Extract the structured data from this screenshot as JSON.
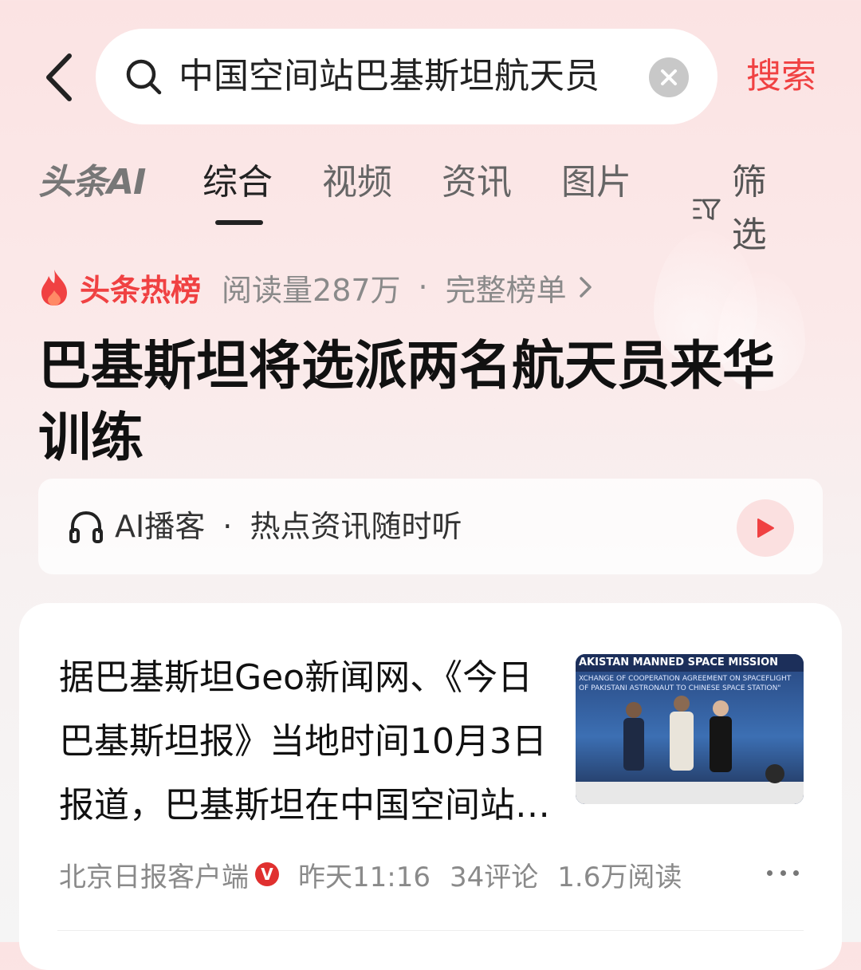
{
  "search": {
    "query": "中国空间站巴基斯坦航天员",
    "action_label": "搜索"
  },
  "tabs": [
    {
      "label": "头条AI"
    },
    {
      "label": "综合",
      "active": true
    },
    {
      "label": "视频"
    },
    {
      "label": "资讯"
    },
    {
      "label": "图片"
    }
  ],
  "filter_label": "筛选",
  "hot": {
    "title": "头条热榜",
    "reads": "阅读量287万",
    "separator": "·",
    "full_list": "完整榜单"
  },
  "headline": "巴基斯坦将选派两名航天员来华训练",
  "podcast": {
    "label": "AI播客",
    "separator": "·",
    "tagline": "热点资讯随时听"
  },
  "article": {
    "text": "据巴基斯坦Geo新闻网、《今日巴基斯坦报》当地时间10月3日报道，巴基斯坦在中国空间站的任务中将选派两名航天员来华接受训练。",
    "thumbnail": {
      "banner_line1": "AKISTAN MANNED SPACE MISSION",
      "banner_line2": "XCHANGE OF COOPERATION AGREEMENT ON SPACEFLIGHT",
      "banner_line3": "OF PAKISTANI ASTRONAUT TO CHINESE SPACE STATION\""
    },
    "source": "北京日报客户端",
    "verified_mark": "V",
    "time": "昨天11:16",
    "comments": "34评论",
    "reads": "1.6万阅读"
  },
  "colors": {
    "accent": "#f04142",
    "background_top": "#fbe3e3",
    "card": "#ffffff"
  }
}
